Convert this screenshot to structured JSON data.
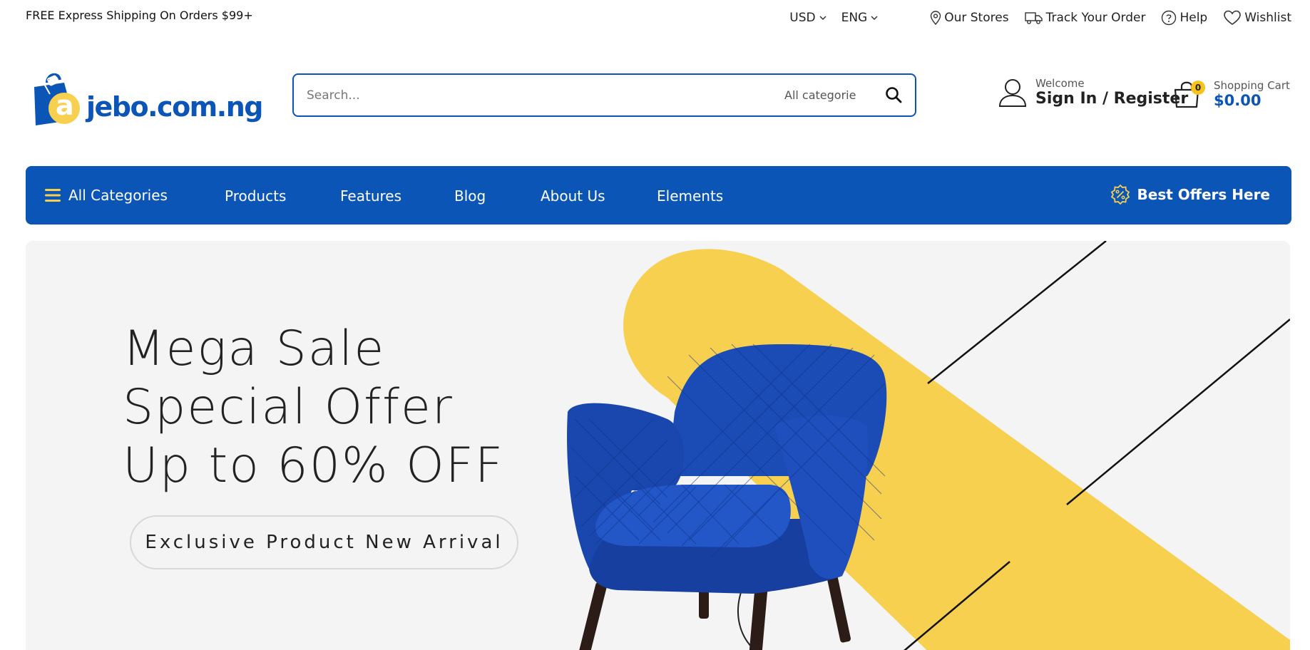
{
  "topbar": {
    "promo": "FREE Express Shipping On Orders $99+",
    "currency": "USD",
    "language": "ENG",
    "links": {
      "stores": "Our Stores",
      "track": "Track Your Order",
      "help": "Help",
      "wishlist": "Wishlist"
    }
  },
  "header": {
    "logo_text": "jebo.com.ng",
    "logo_letter": "a",
    "search": {
      "placeholder": "Search...",
      "category": "All categorie"
    },
    "account": {
      "welcome": "Welcome",
      "action": "Sign In / Register"
    },
    "cart": {
      "count": "0",
      "label": "Shopping Cart",
      "total": "$0.00"
    }
  },
  "nav": {
    "all_categories": "All Categories",
    "items": [
      "Products",
      "Features",
      "Blog",
      "About Us",
      "Elements"
    ],
    "offers": "Best Offers Here"
  },
  "hero": {
    "line1": "Mega Sale",
    "line2": "Special Offer",
    "line3": "Up to 60% OFF",
    "cta": "Exclusive Product New Arrival"
  },
  "colors": {
    "brand_blue": "#0b55b6",
    "accent_yellow": "#f7d04f",
    "badge_yellow": "#f7c31f",
    "hero_bg": "#f4f4f4"
  }
}
